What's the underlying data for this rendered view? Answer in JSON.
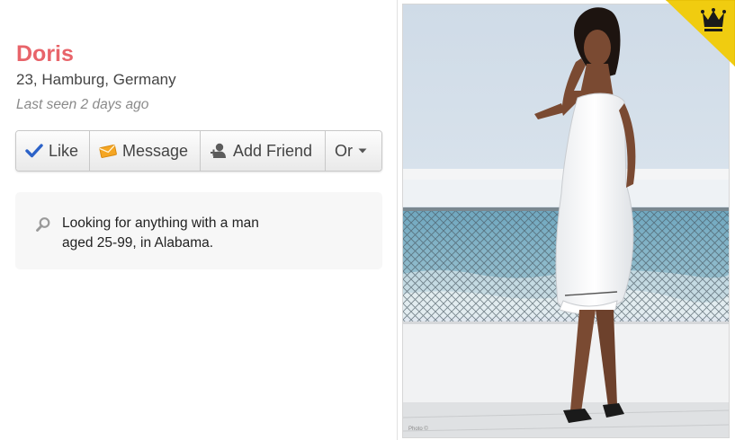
{
  "profile": {
    "name": "Doris",
    "details": "23, Hamburg, Germany",
    "last_seen": "Last seen 2 days ago"
  },
  "actions": {
    "like": "Like",
    "message": "Message",
    "add_friend": "Add Friend",
    "more": "Or"
  },
  "seeking": {
    "line1": "Looking for anything with a man",
    "line2": "aged 25-99, in Alabama."
  },
  "photo": {
    "watermark": "Photo ©"
  },
  "badges": {
    "premium_icon": "crown-icon",
    "premium_color": "#f3d20c"
  },
  "colors": {
    "name": "#e8646a",
    "like_check": "#2c62c8",
    "message_envelope": "#f5a623"
  }
}
